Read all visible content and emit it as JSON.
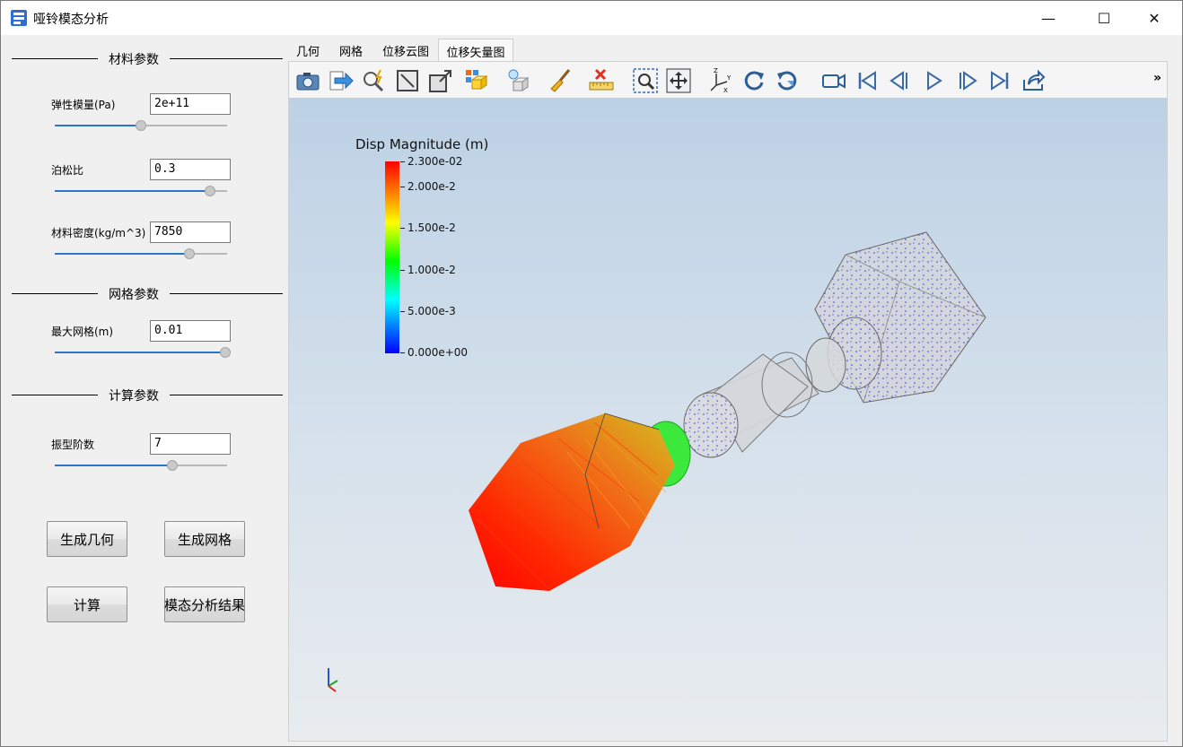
{
  "window": {
    "title": "哑铃模态分析",
    "minimize_glyph": "—",
    "maximize_glyph": "☐",
    "close_glyph": "✕"
  },
  "sections": {
    "material": "材料参数",
    "mesh": "网格参数",
    "calc": "计算参数"
  },
  "params": {
    "elastic_modulus": {
      "label": "弹性模量(Pa)",
      "value": "2e+11",
      "slider_level": 0.5
    },
    "poisson": {
      "label": "泊松比",
      "value": "0.3",
      "slider_level": 0.9
    },
    "density": {
      "label": "材料密度(kg/m^3)",
      "value": "7850",
      "slider_level": 0.78
    },
    "max_mesh": {
      "label": "最大网格(m)",
      "value": "0.01",
      "slider_level": 0.99
    },
    "modes": {
      "label": "振型阶数",
      "value": "7",
      "slider_level": 0.68
    }
  },
  "buttons": {
    "gen_geometry": "生成几何",
    "gen_mesh": "生成网格",
    "calculate": "计算",
    "modal_results": "模态分析结果"
  },
  "tabs": [
    "几何",
    "网格",
    "位移云图",
    "位移矢量图"
  ],
  "active_tab": 3,
  "toolbar": {
    "icons": [
      "camera-icon",
      "export-arrow-icon",
      "zoom-auto-icon",
      "reset-view-icon",
      "resize-icon",
      "box-select-icon",
      "light-bulb-icon",
      "brush-icon",
      "ruler-clear-icon",
      "zoom-box-icon",
      "pan-icon",
      "axes-orientation-icon",
      "rotate-cw-icon",
      "rotate-ccw-icon",
      "camera-record-icon",
      "first-frame-icon",
      "prev-frame-icon",
      "play-icon",
      "next-frame-icon",
      "last-frame-icon",
      "share-icon"
    ],
    "more": "»"
  },
  "legend": {
    "title": "Disp Magnitude (m)",
    "labels": [
      "2.300e-02",
      "2.000e-2",
      "1.500e-2",
      "1.000e-2",
      "5.000e-3",
      "0.000e+00"
    ],
    "values": [
      0.023,
      0.02,
      0.015,
      0.01,
      0.005,
      0.0
    ],
    "colors": [
      "#ff0000",
      "#ff8c00",
      "#ffff00",
      "#00ff00",
      "#00ffff",
      "#0000ff"
    ]
  }
}
